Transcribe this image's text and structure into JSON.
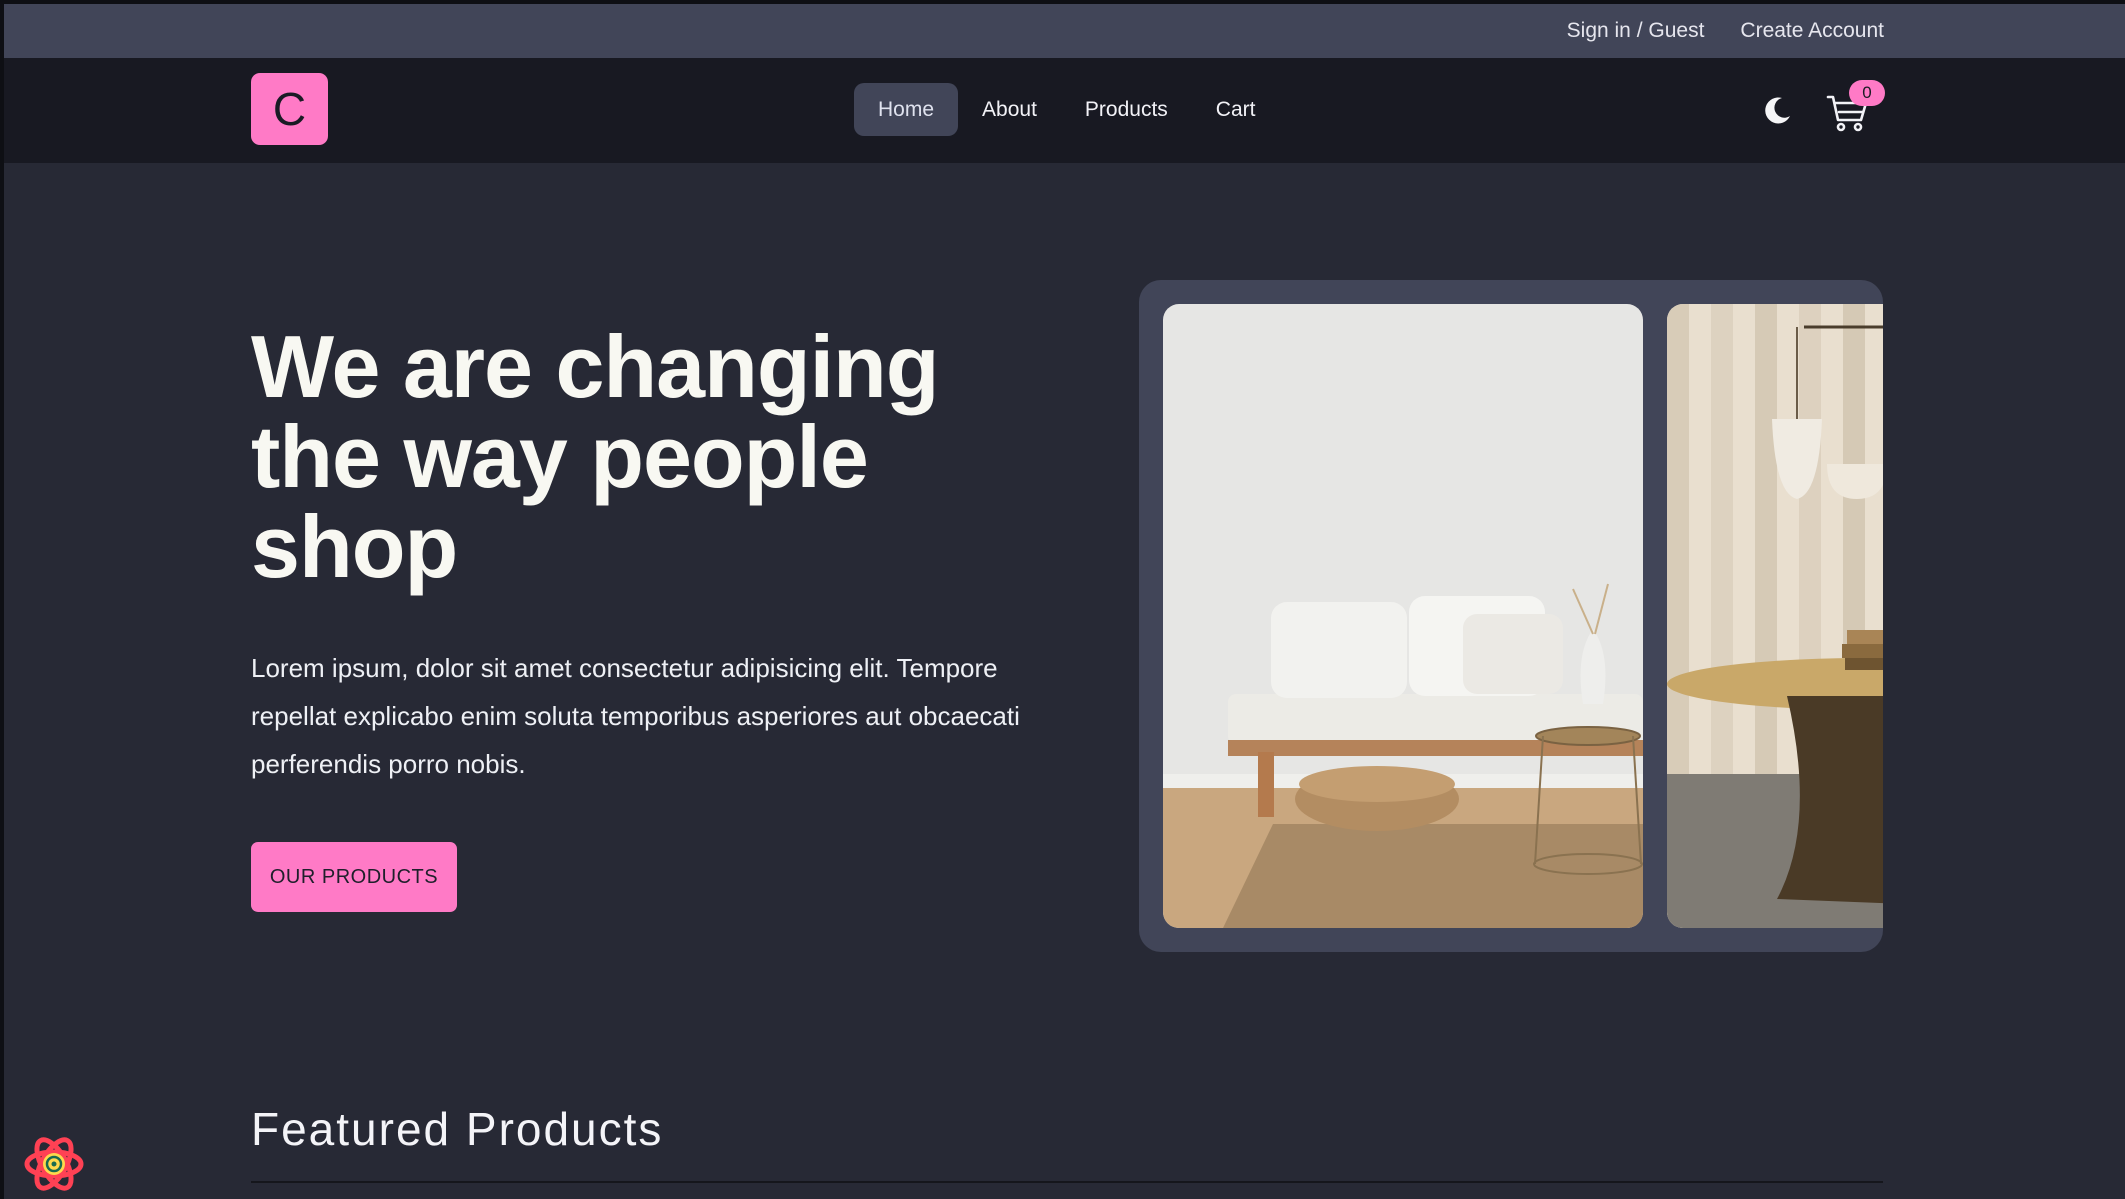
{
  "topbar": {
    "signin_label": "Sign in / Guest",
    "create_account_label": "Create Account"
  },
  "navbar": {
    "logo_letter": "C",
    "links": [
      {
        "label": "Home",
        "active": true
      },
      {
        "label": "About",
        "active": false
      },
      {
        "label": "Products",
        "active": false
      },
      {
        "label": "Cart",
        "active": false
      }
    ],
    "theme_icon": "moon-icon",
    "cart_icon": "cart-icon",
    "cart_count": "0"
  },
  "hero": {
    "title": "We are changing the way people shop",
    "text": "Lorem ipsum, dolor sit amet consectetur adipisicing elit. Tempore repellat explicabo enim soluta temporibus asperiores aut obcaecati perferendis porro nobis.",
    "cta_label": "OUR PRODUCTS"
  },
  "featured": {
    "title": "Featured Products"
  },
  "colors": {
    "accent": "#ff7ac6",
    "background": "#272935",
    "navbar": "#181922",
    "topbar": "#414558"
  }
}
